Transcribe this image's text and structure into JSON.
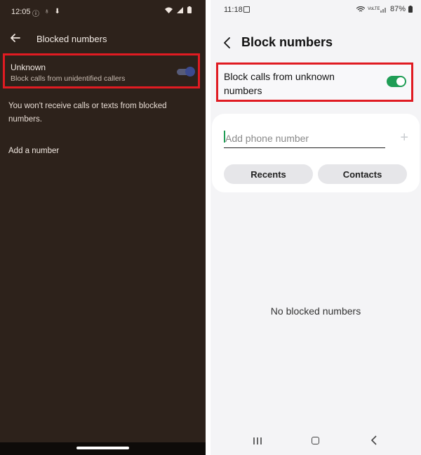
{
  "left": {
    "status": {
      "time": "12:05"
    },
    "appbar": {
      "title": "Blocked numbers"
    },
    "unknown": {
      "title": "Unknown",
      "subtitle": "Block calls from unidentified callers",
      "enabled": true
    },
    "info_text": "You won't receive calls or texts from blocked numbers.",
    "add_number": "Add a number"
  },
  "right": {
    "status": {
      "time": "11:18",
      "carrier": "VoLTE",
      "battery": "87%"
    },
    "appbar": {
      "title": "Block numbers"
    },
    "block_unknown": {
      "label": "Block calls from unknown numbers",
      "enabled": true
    },
    "phone_input": {
      "placeholder": "Add phone number",
      "value": ""
    },
    "buttons": {
      "recents": "Recents",
      "contacts": "Contacts"
    },
    "empty_state": "No blocked numbers"
  },
  "colors": {
    "left_bg": "#2d221b",
    "highlight": "#e01b22",
    "toggle_on": "#1f9d55"
  }
}
